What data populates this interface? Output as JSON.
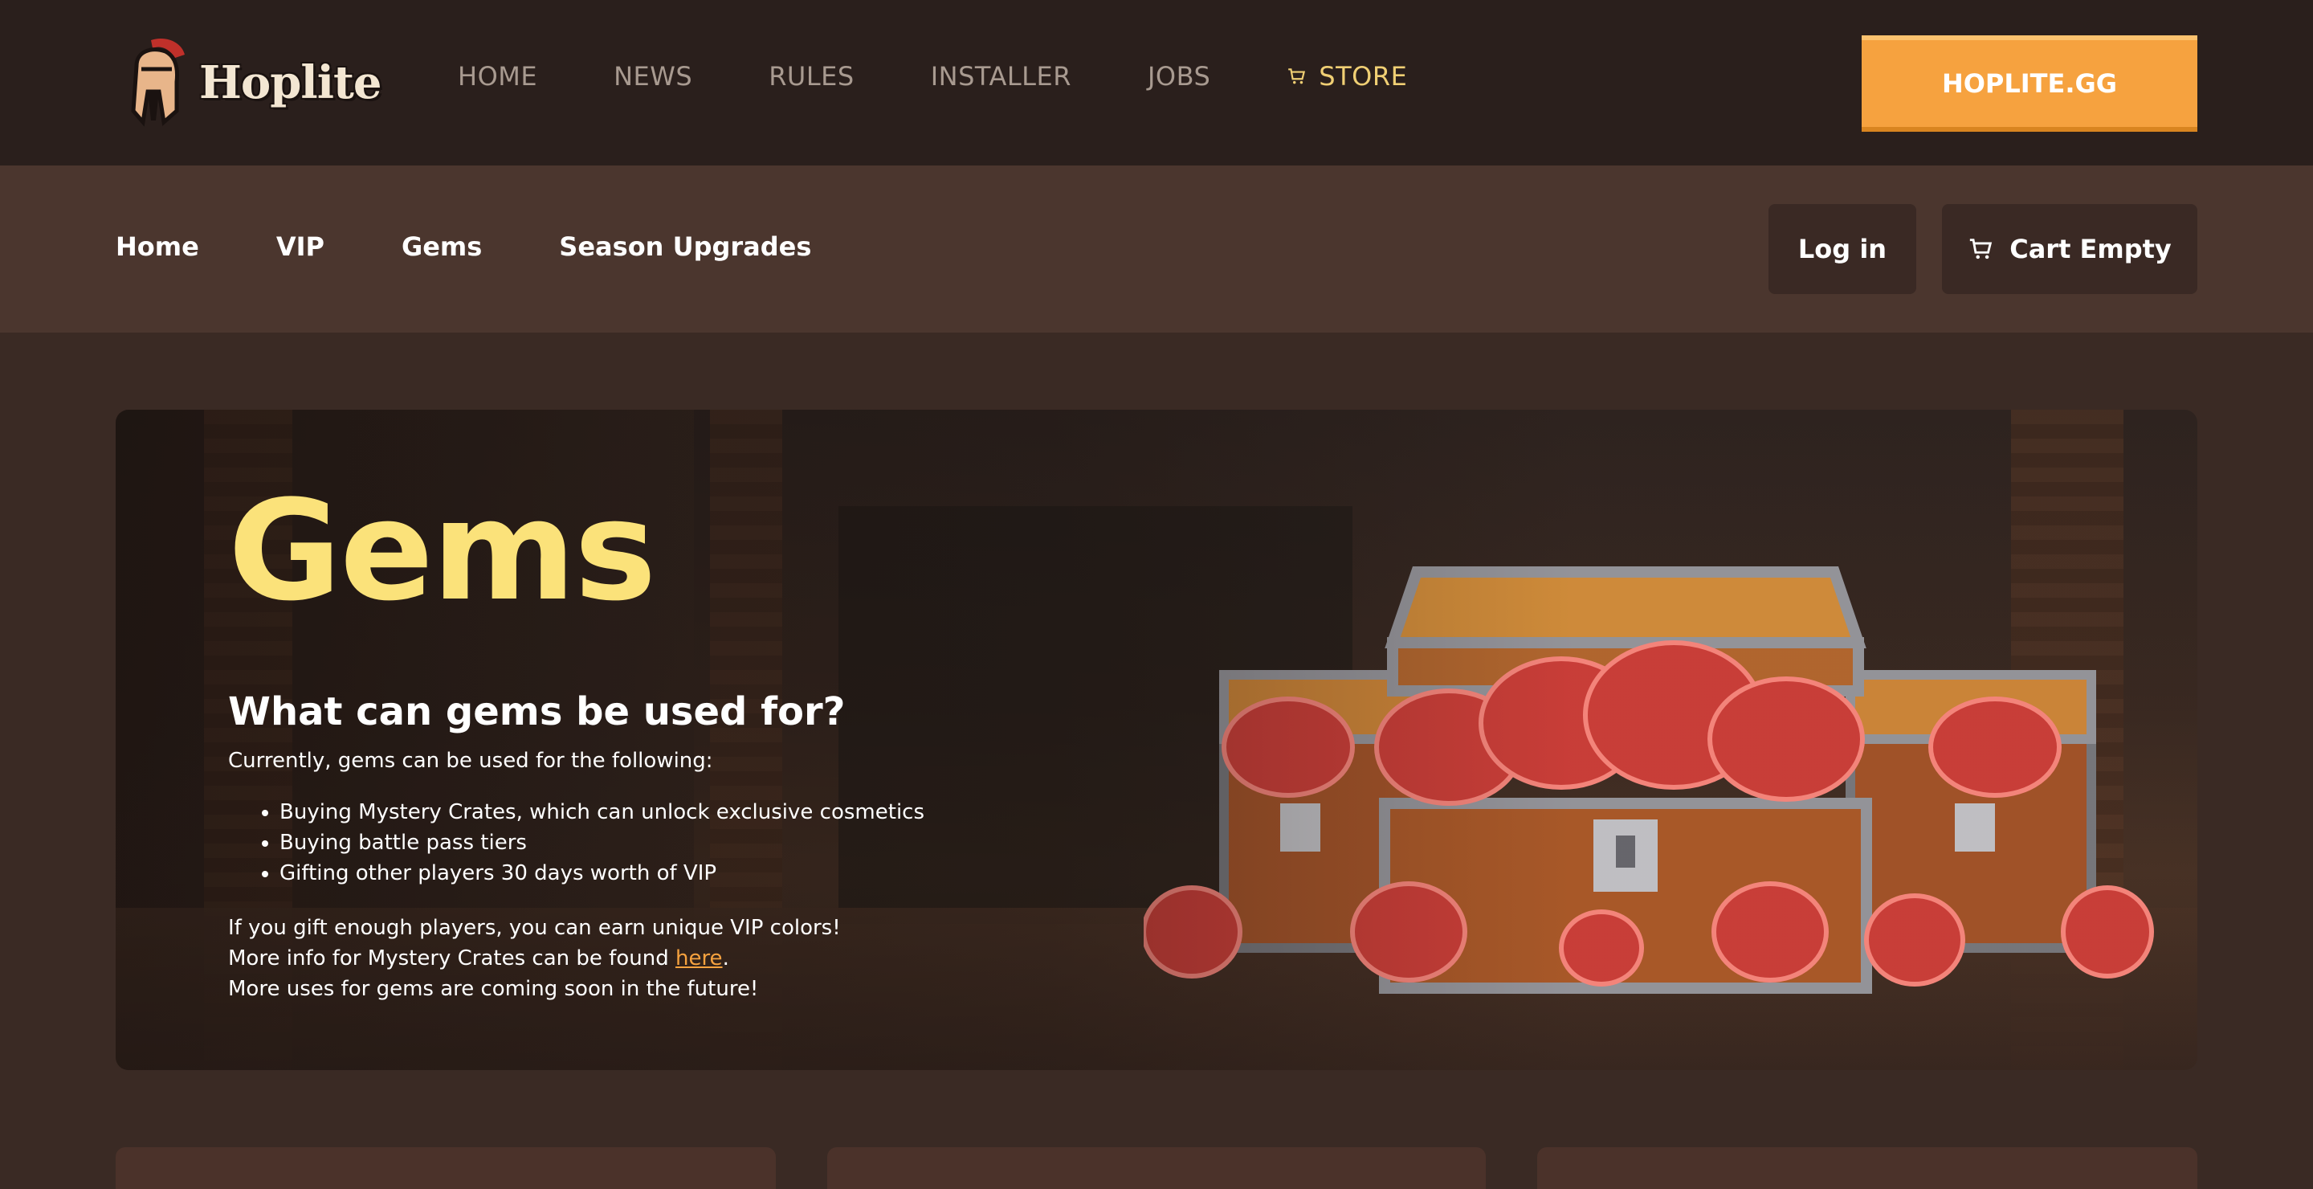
{
  "brand": {
    "name": "Hoplite"
  },
  "topnav": {
    "items": [
      "HOME",
      "NEWS",
      "RULES",
      "INSTALLER",
      "JOBS"
    ],
    "store_label": "STORE",
    "cta_label": "HOPLITE.GG"
  },
  "subnav": {
    "items": [
      "Home",
      "VIP",
      "Gems",
      "Season Upgrades"
    ],
    "login_label": "Log in",
    "cart_label": "Cart Empty"
  },
  "hero": {
    "title": "Gems",
    "subtitle": "What can gems be used for?",
    "intro": "Currently, gems can be used for the following:",
    "list": [
      "Buying Mystery Crates, which can unlock exclusive cosmetics",
      "Buying battle pass tiers",
      "Gifting other players 30 days worth of VIP"
    ],
    "note1": "If you gift enough players, you can earn unique VIP colors!",
    "note2_prefix": "More info for Mystery Crates can be found ",
    "note2_link": "here",
    "note2_suffix": ".",
    "note3": "More uses for gems are coming soon in the future!"
  },
  "colors": {
    "accent": "#f6a23f",
    "title": "#fbe27a",
    "topbar": "#2a1f1c",
    "subbar": "#4b362e"
  },
  "icons": {
    "store": "cart-icon",
    "cart": "cart-icon",
    "logo": "spartan-helmet-icon"
  }
}
